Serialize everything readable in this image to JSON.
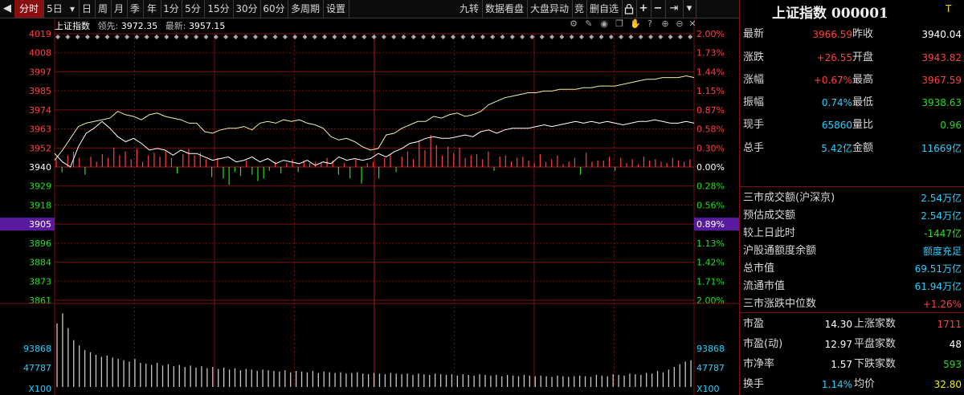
{
  "toolbar": {
    "items": [
      "分时",
      "5日",
      "日",
      "周",
      "月",
      "季",
      "年",
      "1分",
      "5分",
      "15分",
      "30分",
      "60分",
      "多周期",
      "设置"
    ],
    "dropdown_glyph": "▾",
    "right_items": [
      "九转",
      "数据看盘",
      "大盘异动",
      "竞",
      "删自选"
    ],
    "right_icons": [
      "lock-icon",
      "plus-icon",
      "minus-icon",
      "jump-end-icon",
      "menu-down-icon"
    ]
  },
  "chart_header": {
    "title": "上证指数",
    "lead_label": "领先:",
    "lead_value": "3972.35",
    "latest_label": "最新:",
    "latest_value": "3957.15"
  },
  "colors": {
    "up": "#ff4040",
    "down": "#22dd22",
    "price_line": "#ffffff",
    "lead_line": "#f0f0a0",
    "grid": "#7a1010",
    "volume": "#c8c8c8",
    "highlight": "#5a1aa0",
    "cyan": "#22d0ff"
  },
  "chart_data": {
    "type": "line",
    "axis": {
      "left_ticks": [
        "4019",
        "4008",
        "3997",
        "3985",
        "3974",
        "3963",
        "3952",
        "3940",
        "3929",
        "3918",
        "3905",
        "3896",
        "3884",
        "3873",
        "3861"
      ],
      "right_ticks": [
        "2.00%",
        "1.73%",
        "1.44%",
        "1.15%",
        "0.87%",
        "0.58%",
        "0.30%",
        "0.00%",
        "0.28%",
        "0.56%",
        "0.89%",
        "1.13%",
        "1.42%",
        "1.71%",
        "2.00%"
      ],
      "highlight_tick": "3905",
      "highlight_tick_right": "0.89%",
      "volume_left_ticks": [
        "93868",
        "47787",
        "X100"
      ],
      "volume_right_ticks": [
        "93868",
        "47787",
        "X100"
      ],
      "ylim": [
        3861,
        4019
      ],
      "prev_close": 3940.04
    },
    "series": [
      {
        "name": "最新",
        "values": [
          3948,
          3943,
          3940,
          3952,
          3960,
          3963,
          3967,
          3963,
          3958,
          3955,
          3957,
          3954,
          3950,
          3951,
          3950,
          3947,
          3950,
          3948,
          3948,
          3946,
          3944,
          3945,
          3946,
          3943,
          3944,
          3946,
          3943,
          3945,
          3942,
          3944,
          3943,
          3942,
          3944,
          3941,
          3943,
          3942,
          3946,
          3944,
          3945,
          3944,
          3945,
          3948,
          3946,
          3949,
          3951,
          3954,
          3955,
          3957,
          3958,
          3957,
          3957,
          3958,
          3959,
          3958,
          3961,
          3962,
          3960,
          3962,
          3963,
          3963,
          3963,
          3964,
          3965,
          3964,
          3965,
          3966,
          3967,
          3966,
          3967,
          3966,
          3967,
          3966,
          3965,
          3966,
          3967,
          3967,
          3968,
          3967,
          3966,
          3966,
          3967,
          3966
        ]
      },
      {
        "name": "领先",
        "values": [
          3944,
          3950,
          3957,
          3964,
          3966,
          3967,
          3968,
          3969,
          3973,
          3971,
          3970,
          3968,
          3971,
          3972,
          3970,
          3969,
          3968,
          3966,
          3966,
          3961,
          3960,
          3962,
          3963,
          3963,
          3964,
          3962,
          3966,
          3967,
          3966,
          3968,
          3967,
          3968,
          3966,
          3965,
          3963,
          3958,
          3956,
          3957,
          3955,
          3952,
          3950,
          3951,
          3959,
          3960,
          3963,
          3965,
          3967,
          3967,
          3970,
          3969,
          3971,
          3972,
          3970,
          3971,
          3973,
          3977,
          3979,
          3981,
          3982,
          3983,
          3984,
          3984,
          3985,
          3985,
          3986,
          3986,
          3986,
          3987,
          3987,
          3988,
          3988,
          3988,
          3989,
          3990,
          3991,
          3992,
          3992,
          3993,
          3993,
          3993,
          3994,
          3993
        ]
      }
    ],
    "tick_bars": [
      6,
      -4,
      9,
      12,
      7,
      -6,
      8,
      4,
      10,
      7,
      15,
      9,
      12,
      6,
      14,
      4,
      9,
      11,
      8,
      12,
      7,
      -5,
      10,
      14,
      9,
      11,
      6,
      -8,
      7,
      -9,
      -14,
      -4,
      -7,
      5,
      -6,
      -11,
      -9,
      -3,
      4,
      -5,
      3,
      6,
      -4,
      5,
      3,
      4,
      3,
      7,
      5,
      -6,
      3,
      -9,
      6,
      -13,
      3,
      4,
      -9,
      7,
      10,
      -4,
      8,
      12,
      6,
      20,
      13,
      25,
      17,
      9,
      16,
      11,
      15,
      7,
      9,
      10,
      6,
      12,
      -3,
      8,
      9,
      4,
      7,
      8,
      5,
      3,
      10,
      4,
      6,
      9,
      2,
      4,
      7,
      -6,
      11,
      4,
      5,
      5,
      8,
      -3,
      7,
      3,
      6,
      2,
      8,
      5,
      6,
      4,
      3,
      7,
      5,
      4,
      6
    ],
    "volume_bars": [
      95,
      110,
      88,
      70,
      62,
      55,
      52,
      48,
      45,
      47,
      44,
      42,
      40,
      38,
      42,
      36,
      35,
      33,
      36,
      32,
      34,
      31,
      33,
      30,
      32,
      29,
      31,
      28,
      30,
      27,
      29,
      26,
      28,
      25,
      27,
      26,
      24,
      26,
      25,
      24,
      23,
      25,
      22,
      24,
      23,
      22,
      24,
      21,
      23,
      22,
      21,
      22,
      20,
      21,
      22,
      20,
      19,
      21,
      20,
      19,
      21,
      20,
      19,
      20,
      18,
      20,
      19,
      18,
      20,
      19,
      18,
      19,
      17,
      19,
      18,
      17,
      19,
      18,
      17,
      18,
      16,
      18,
      17,
      16,
      18,
      17,
      16,
      17,
      16,
      15,
      17,
      16,
      15,
      16,
      17,
      16,
      15,
      18,
      17,
      16,
      19,
      18,
      17,
      20,
      19,
      18,
      21,
      20,
      24,
      22,
      26,
      30,
      34,
      38,
      40
    ]
  },
  "quote": {
    "title": "上证指数 000001",
    "t_badge": "T",
    "rows": [
      {
        "l1": "最新",
        "v1": "3966.59",
        "c1": "red",
        "l2": "昨收",
        "v2": "3940.04",
        "c2": "white"
      },
      {
        "l1": "涨跌",
        "v1": "+26.55",
        "c1": "red",
        "l2": "开盘",
        "v2": "3943.82",
        "c2": "red"
      },
      {
        "l1": "涨幅",
        "v1": "+0.67%",
        "c1": "red",
        "l2": "最高",
        "v2": "3967.59",
        "c2": "red"
      },
      {
        "l1": "振幅",
        "v1": "0.74%",
        "c1": "cyan",
        "l2": "最低",
        "v2": "3938.63",
        "c2": "green"
      },
      {
        "l1": "现手",
        "v1": "65860",
        "c1": "cyan",
        "l2": "量比",
        "v2": "0.96",
        "c2": "green"
      },
      {
        "l1": "总手",
        "v1": "5.42亿",
        "c1": "cyan",
        "l2": "金额",
        "v2": "11669亿",
        "c2": "cyan"
      }
    ],
    "stats": [
      {
        "l": "三市成交额(沪深京)",
        "v": "2.54万亿",
        "c": "cyan"
      },
      {
        "l": "预估成交额",
        "v": "2.54万亿",
        "c": "cyan"
      },
      {
        "l": "较上日此时",
        "v": "-1447亿",
        "c": "green"
      },
      {
        "l": "沪股通额度余额",
        "v": "额度充足",
        "c": "cyan"
      },
      {
        "l": "总市值",
        "v": "69.51万亿",
        "c": "cyan"
      },
      {
        "l": "流通市值",
        "v": "61.94万亿",
        "c": "cyan"
      },
      {
        "l": "三市涨跌中位数",
        "v": "+1.26%",
        "c": "red"
      }
    ],
    "bottom": [
      {
        "l1": "市盈",
        "v1": "14.30",
        "c1": "white",
        "l2": "上涨家数",
        "v2": "1711",
        "c2": "red"
      },
      {
        "l1": "市盈(动)",
        "v1": "12.97",
        "c1": "white",
        "l2": "平盘家数",
        "v2": "48",
        "c2": "white"
      },
      {
        "l1": "市净率",
        "v1": "1.57",
        "c1": "white",
        "l2": "下跌家数",
        "v2": "593",
        "c2": "green"
      },
      {
        "l1": "换手",
        "v1": "1.14%",
        "c1": "cyan",
        "l2": "均价",
        "v2": "32.80",
        "c2": "yellow"
      }
    ]
  }
}
